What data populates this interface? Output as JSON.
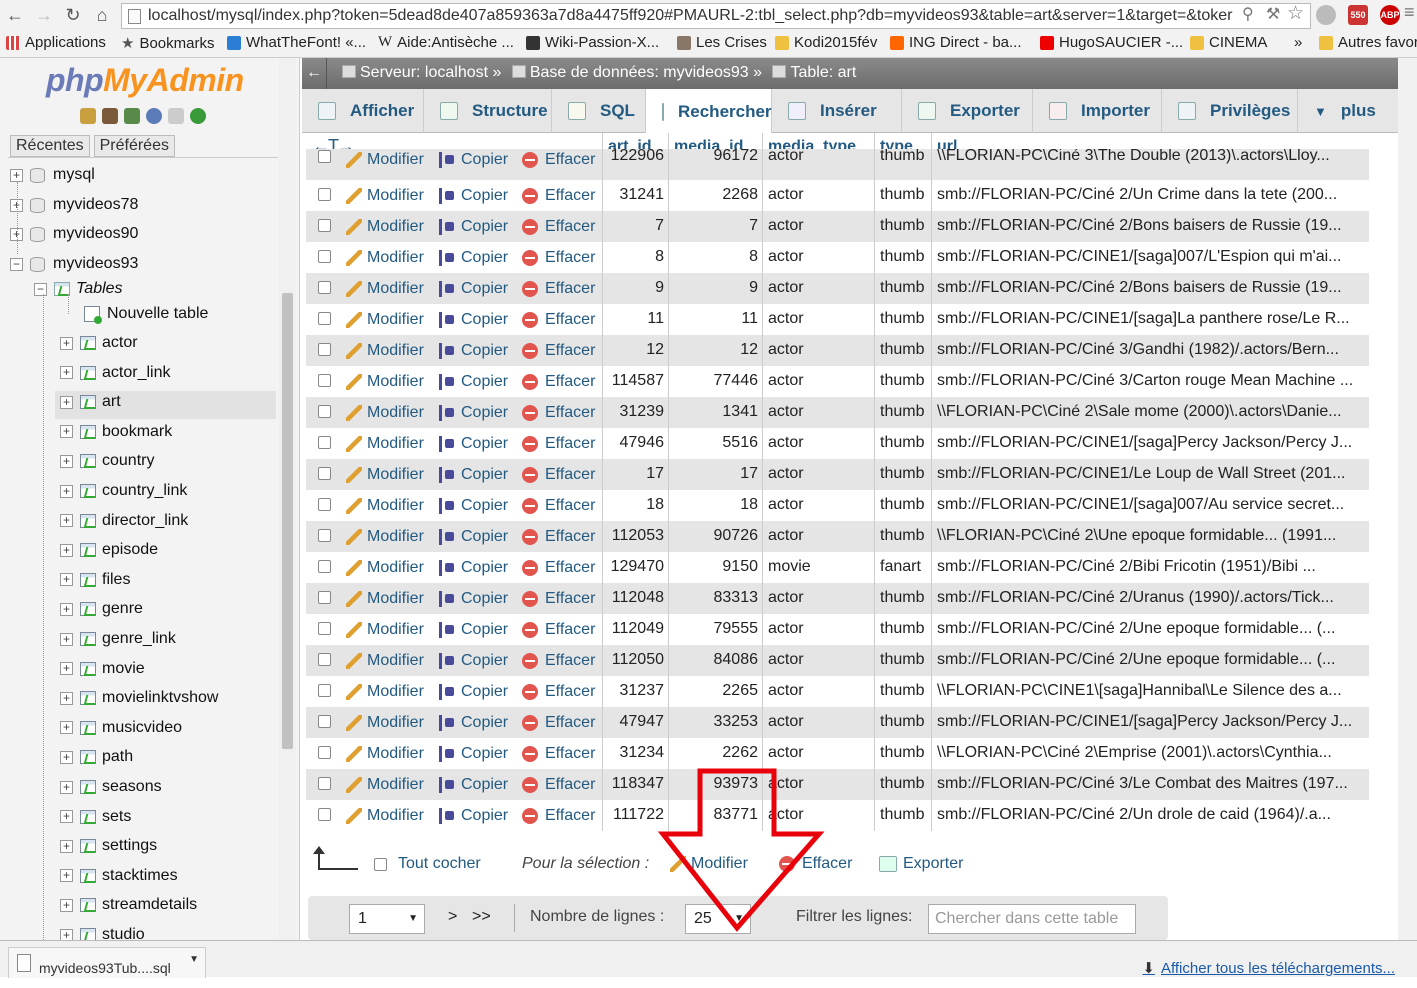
{
  "browser": {
    "url": "localhost/mysql/index.php?token=5dead8de407a859363a7d8a4475ff920#PMAURL-2:tbl_select.php?db=myvideos93&table=art&server=1&target=&toker",
    "bookmarks": [
      "Applications",
      "Bookmarks",
      "WhatTheFont! «...",
      "Aide:Antisèche ...",
      "Wiki-Passion-X...",
      "Les Crises",
      "Kodi2015fév",
      "ING Direct - ba...",
      "HugoSAUCIER -...",
      "CINEMA",
      "»",
      "Autres favoris"
    ],
    "ext_badge": "550",
    "abp": "ABP"
  },
  "sidebar": {
    "logo_php": "php",
    "logo_myadmin": "MyAdmin",
    "tab_recent": "Récentes",
    "tab_fav": "Préférées",
    "databases": [
      "mysql",
      "myvideos78",
      "myvideos90",
      "myvideos93"
    ],
    "tables_label": "Tables",
    "new_table": "Nouvelle table",
    "tables": [
      "actor",
      "actor_link",
      "art",
      "bookmark",
      "country",
      "country_link",
      "director_link",
      "episode",
      "files",
      "genre",
      "genre_link",
      "movie",
      "movielinktvshow",
      "musicvideo",
      "path",
      "seasons",
      "sets",
      "settings",
      "stacktimes",
      "streamdetails",
      "studio"
    ],
    "selected_table": "art"
  },
  "breadcrumb": {
    "server": "Serveur: localhost »",
    "database": "Base de données: myvideos93 »",
    "table": "Table: art"
  },
  "tabs": [
    "Afficher",
    "Structure",
    "SQL",
    "Rechercher",
    "Insérer",
    "Exporter",
    "Importer",
    "Privilèges",
    "plus"
  ],
  "active_tab": "Rechercher",
  "columns": [
    "art_id",
    "media_id",
    "media_type",
    "type",
    "url"
  ],
  "actions": {
    "edit": "Modifier",
    "copy": "Copier",
    "delete": "Effacer"
  },
  "rows": [
    {
      "art_id": "122906",
      "media_id": "96172",
      "media_type": "actor",
      "type": "thumb",
      "url": "\\\\FLORIAN-PC\\Ciné 3\\The Double (2013)\\.actors\\Lloy..."
    },
    {
      "art_id": "31241",
      "media_id": "2268",
      "media_type": "actor",
      "type": "thumb",
      "url": "smb://FLORIAN-PC/Ciné 2/Un Crime dans la tete (200..."
    },
    {
      "art_id": "7",
      "media_id": "7",
      "media_type": "actor",
      "type": "thumb",
      "url": "smb://FLORIAN-PC/Ciné 2/Bons baisers de Russie (19..."
    },
    {
      "art_id": "8",
      "media_id": "8",
      "media_type": "actor",
      "type": "thumb",
      "url": "smb://FLORIAN-PC/CINE1/[saga]007/L'Espion qui m'ai..."
    },
    {
      "art_id": "9",
      "media_id": "9",
      "media_type": "actor",
      "type": "thumb",
      "url": "smb://FLORIAN-PC/Ciné 2/Bons baisers de Russie (19..."
    },
    {
      "art_id": "11",
      "media_id": "11",
      "media_type": "actor",
      "type": "thumb",
      "url": "smb://FLORIAN-PC/CINE1/[saga]La panthere rose/Le R..."
    },
    {
      "art_id": "12",
      "media_id": "12",
      "media_type": "actor",
      "type": "thumb",
      "url": "smb://FLORIAN-PC/Ciné 3/Gandhi (1982)/.actors/Bern..."
    },
    {
      "art_id": "114587",
      "media_id": "77446",
      "media_type": "actor",
      "type": "thumb",
      "url": "smb://FLORIAN-PC/Ciné 3/Carton rouge Mean Machine ..."
    },
    {
      "art_id": "31239",
      "media_id": "1341",
      "media_type": "actor",
      "type": "thumb",
      "url": "\\\\FLORIAN-PC\\Ciné 2\\Sale mome (2000)\\.actors\\Danie..."
    },
    {
      "art_id": "47946",
      "media_id": "5516",
      "media_type": "actor",
      "type": "thumb",
      "url": "smb://FLORIAN-PC/CINE1/[saga]Percy Jackson/Percy J..."
    },
    {
      "art_id": "17",
      "media_id": "17",
      "media_type": "actor",
      "type": "thumb",
      "url": "smb://FLORIAN-PC/CINE1/Le Loup de Wall Street (201..."
    },
    {
      "art_id": "18",
      "media_id": "18",
      "media_type": "actor",
      "type": "thumb",
      "url": "smb://FLORIAN-PC/CINE1/[saga]007/Au service secret..."
    },
    {
      "art_id": "112053",
      "media_id": "90726",
      "media_type": "actor",
      "type": "thumb",
      "url": "\\\\FLORIAN-PC\\Ciné 2\\Une epoque formidable... (1991..."
    },
    {
      "art_id": "129470",
      "media_id": "9150",
      "media_type": "movie",
      "type": "fanart",
      "url": "smb://FLORIAN-PC/Ciné 2/Bibi Fricotin (1951)/Bibi ..."
    },
    {
      "art_id": "112048",
      "media_id": "83313",
      "media_type": "actor",
      "type": "thumb",
      "url": "smb://FLORIAN-PC/Ciné 2/Uranus (1990)/.actors/Tick..."
    },
    {
      "art_id": "112049",
      "media_id": "79555",
      "media_type": "actor",
      "type": "thumb",
      "url": "smb://FLORIAN-PC/Ciné 2/Une epoque formidable... (..."
    },
    {
      "art_id": "112050",
      "media_id": "84086",
      "media_type": "actor",
      "type": "thumb",
      "url": "smb://FLORIAN-PC/Ciné 2/Une epoque formidable... (..."
    },
    {
      "art_id": "31237",
      "media_id": "2265",
      "media_type": "actor",
      "type": "thumb",
      "url": "\\\\FLORIAN-PC\\CINE1\\[saga]Hannibal\\Le Silence des a..."
    },
    {
      "art_id": "47947",
      "media_id": "33253",
      "media_type": "actor",
      "type": "thumb",
      "url": "smb://FLORIAN-PC/CINE1/[saga]Percy Jackson/Percy J..."
    },
    {
      "art_id": "31234",
      "media_id": "2262",
      "media_type": "actor",
      "type": "thumb",
      "url": "\\\\FLORIAN-PC\\Ciné 2\\Emprise (2001)\\.actors\\Cynthia..."
    },
    {
      "art_id": "118347",
      "media_id": "93973",
      "media_type": "actor",
      "type": "thumb",
      "url": "smb://FLORIAN-PC/Ciné 3/Le Combat des Maitres (197..."
    },
    {
      "art_id": "111722",
      "media_id": "83771",
      "media_type": "actor",
      "type": "thumb",
      "url": "smb://FLORIAN-PC/Ciné 2/Un drole de caid (1964)/.a..."
    }
  ],
  "bulk": {
    "check_all": "Tout cocher",
    "for_selection": "Pour la sélection :",
    "edit": "Modifier",
    "delete": "Effacer",
    "export": "Exporter"
  },
  "pager": {
    "page": "1",
    "next": ">",
    "last": ">>",
    "rows_label": "Nombre de lignes :",
    "rows_value": "25",
    "filter_label": "Filtrer les lignes:",
    "filter_placeholder": "Chercher dans cette table"
  },
  "downloads": {
    "file": "myvideos93Tub....sql",
    "show_all": "Afficher tous les téléchargements..."
  },
  "colors": {
    "link": "#235a81",
    "annotation_arrow": "#e8000a",
    "stripe": "#e5e5e5"
  }
}
